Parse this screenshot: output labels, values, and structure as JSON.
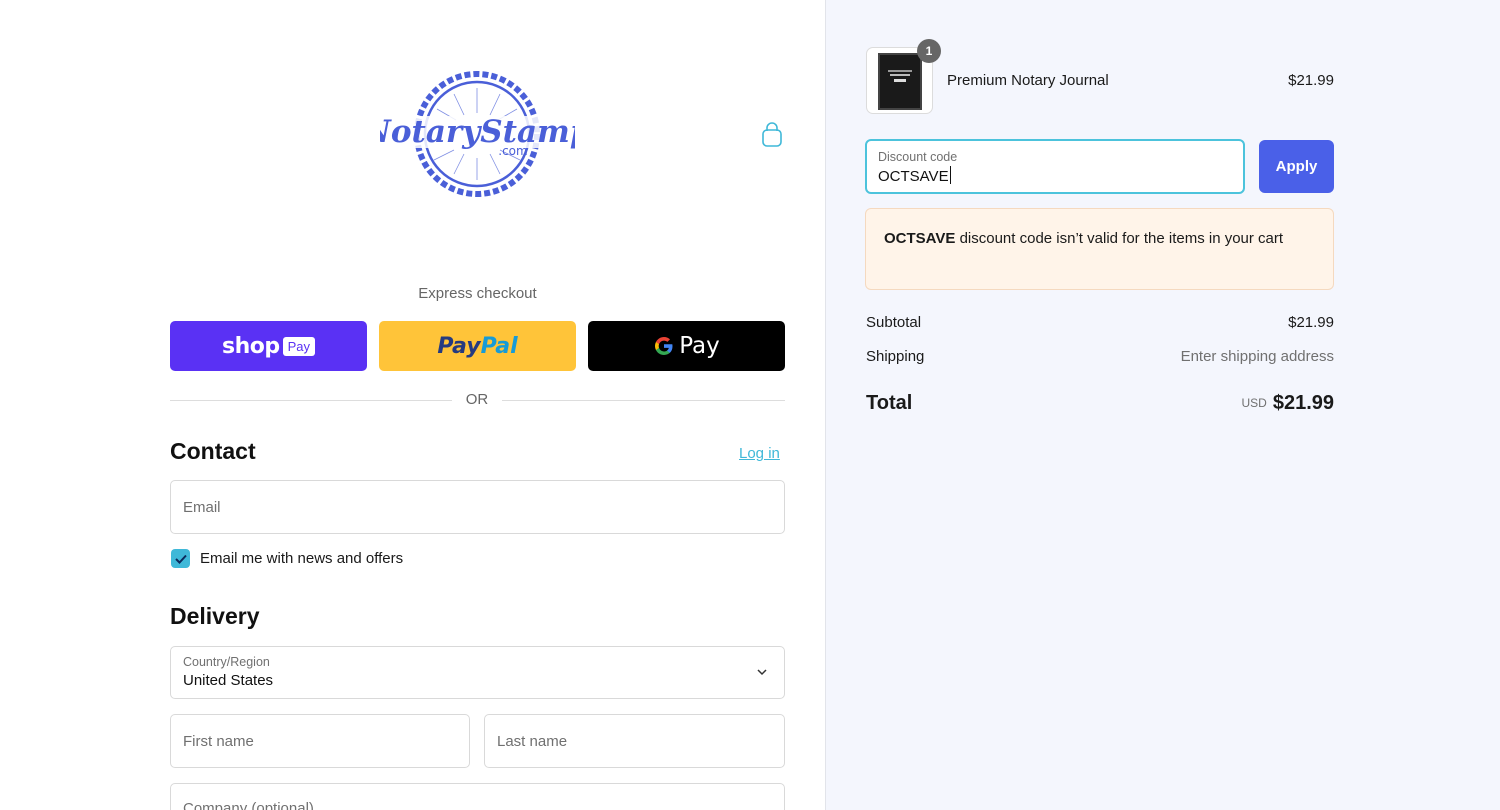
{
  "brand": {
    "logo_text": "NotaryStamp",
    "logo_sub": ".com",
    "accent": "#4a60e8"
  },
  "express": {
    "label": "Express checkout",
    "shop_word": "shop",
    "shop_pay": "Pay",
    "paypal_1": "Pay",
    "paypal_2": "Pal",
    "gpay_word": "Pay",
    "or": "OR"
  },
  "contact": {
    "title": "Contact",
    "login": "Log in",
    "email_placeholder": "Email",
    "newsletter_label": "Email me with news and offers",
    "newsletter_checked": true
  },
  "delivery": {
    "title": "Delivery",
    "country_label": "Country/Region",
    "country_value": "United States",
    "first_name": "First name",
    "last_name": "Last name",
    "company": "Company (optional)"
  },
  "cart": {
    "item_name": "Premium Notary Journal",
    "item_price": "$21.99",
    "quantity": "1"
  },
  "discount": {
    "label": "Discount code",
    "value": "OCTSAVE",
    "apply": "Apply",
    "error_code": "OCTSAVE",
    "error_text": " discount code isn’t valid for the items in your cart"
  },
  "summary": {
    "subtotal_label": "Subtotal",
    "subtotal_value": "$21.99",
    "shipping_label": "Shipping",
    "shipping_value": "Enter shipping address",
    "total_label": "Total",
    "currency": "USD",
    "total_value": "$21.99"
  }
}
